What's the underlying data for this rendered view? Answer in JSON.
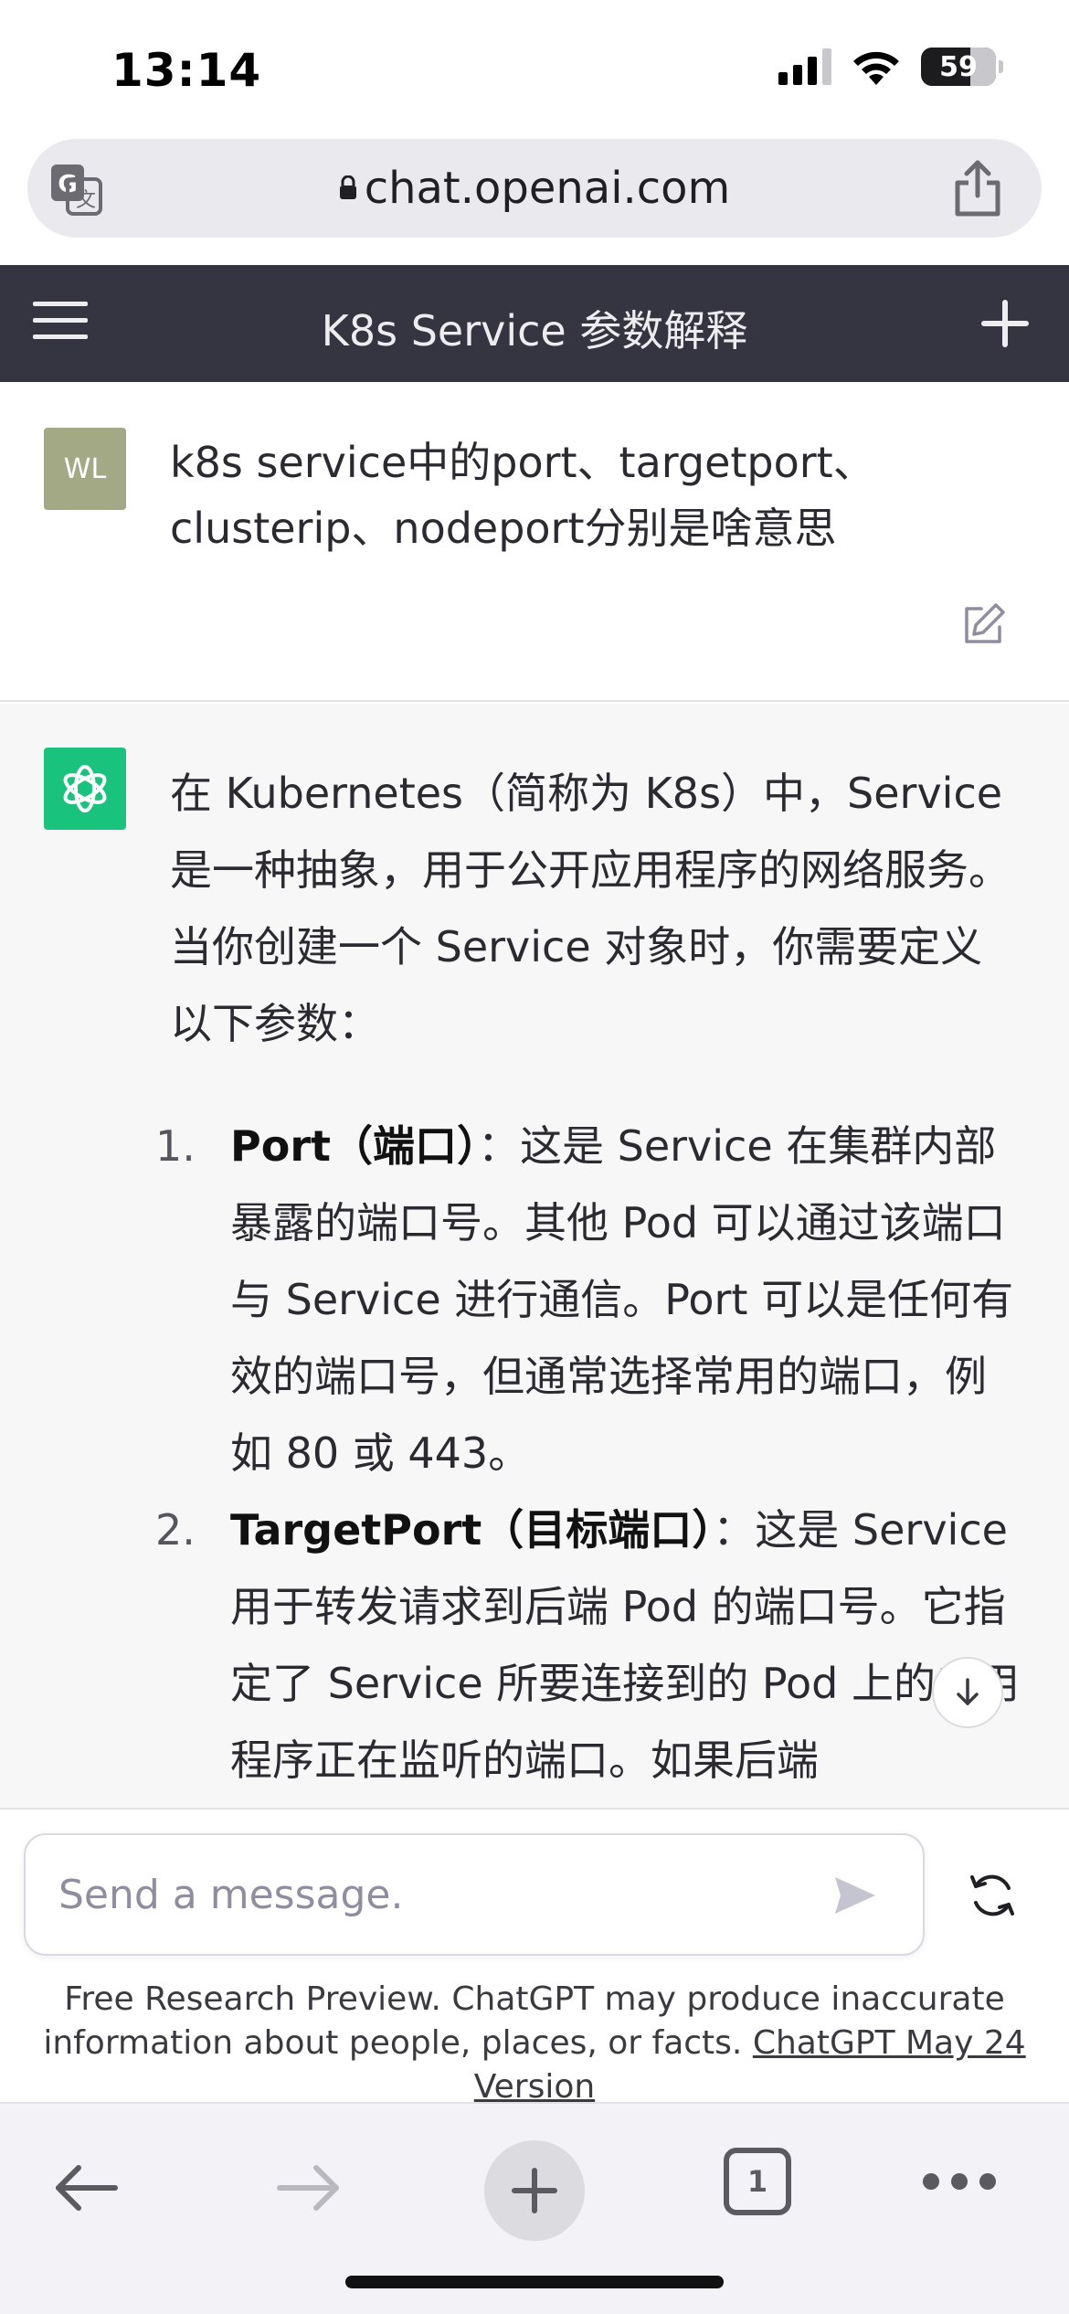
{
  "status_bar": {
    "time": "13:14",
    "battery": "59",
    "icons": [
      "signal-icon",
      "wifi-icon",
      "battery-icon"
    ]
  },
  "browser": {
    "url": "chat.openai.com",
    "icons": [
      "translate-icon",
      "lock-icon",
      "share-icon"
    ]
  },
  "header": {
    "title": "K8s Service 参数解释",
    "icons": [
      "menu-icon",
      "plus-icon"
    ]
  },
  "user_message": {
    "avatar": "WL",
    "text": "k8s service中的port、targetport、clusterip、nodeport分别是啥意思"
  },
  "assistant_message": {
    "intro": "在 Kubernetes（简称为 K8s）中，Service 是一种抽象，用于公开应用程序的网络服务。当你创建一个 Service 对象时，你需要定义以下参数：",
    "items": [
      {
        "num": "1.",
        "term": "Port（端口）",
        "text": "：这是 Service 在集群内部暴露的端口号。其他 Pod 可以通过该端口与 Service 进行通信。Port 可以是任何有效的端口号，但通常选择常用的端口，例如 80 或 443。"
      },
      {
        "num": "2.",
        "term": "TargetPort（目标端口）",
        "text": "：这是 Service 用于转发请求到后端 Pod 的端口号。它指定了 Service 所要连接到的 Pod 上的应用程序正在监听的端口。如果后端"
      }
    ]
  },
  "composer": {
    "placeholder": "Send a message.",
    "disclaimer": "Free Research Preview. ChatGPT may produce inaccurate information about people, places, or facts.",
    "version_link": "ChatGPT May 24 Version"
  },
  "toolbar": {
    "tab_count": "1"
  },
  "colors": {
    "header_bg": "#343541",
    "gpt_green": "#19c37d",
    "user_avatar": "#a3a885",
    "assistant_bg": "#f7f7f8"
  }
}
